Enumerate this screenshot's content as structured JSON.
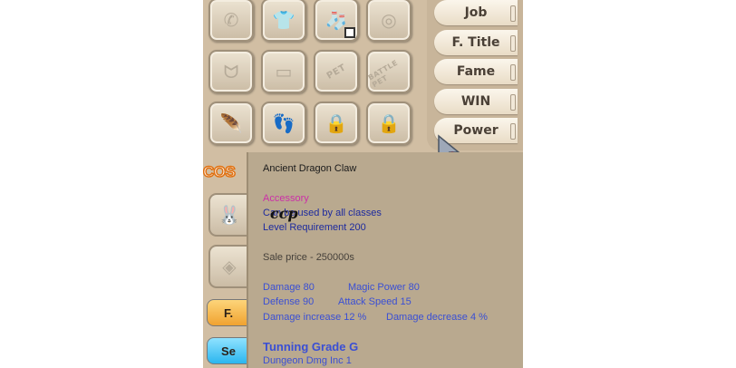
{
  "grid": {
    "slots": [
      {
        "name": "phone-icon",
        "glyph": "✆"
      },
      {
        "name": "shirt-icon",
        "glyph": "👕"
      },
      {
        "name": "sock-icon",
        "glyph": "🧦"
      },
      {
        "name": "ring-icon",
        "glyph": "◎"
      },
      {
        "name": "necklace-icon",
        "glyph": "ᗢ"
      },
      {
        "name": "shorts-icon",
        "glyph": "▭"
      },
      {
        "name": "pet-icon",
        "text": "PET"
      },
      {
        "name": "battle-pet-icon",
        "text": "BATTLE PET"
      },
      {
        "name": "dragon-claw-icon",
        "glyph": "🪶"
      },
      {
        "name": "footprint-icon",
        "glyph": "👣"
      },
      {
        "name": "lock-icon",
        "glyph": "🔒"
      },
      {
        "name": "lock-icon",
        "glyph": "🔒"
      }
    ]
  },
  "right_panel": {
    "buttons": [
      "Job",
      "F. Title",
      "Fame",
      "WIN",
      "Power"
    ]
  },
  "sidebar": {
    "costume_label": "COS",
    "btn1_label": "F.",
    "btn2_label": "Se"
  },
  "tooltip": {
    "item_name": "Ancient Dragon Claw",
    "category": "Accessory",
    "usable_by": "Can be used by all classes",
    "level_req": "Level Requirement 200",
    "sale_price": "Sale price - 250000s",
    "damage": "Damage 80",
    "magic_power": "Magic Power 80",
    "defense": "Defense 90",
    "attack_speed": "Attack Speed 15",
    "damage_increase": "Damage increase 12 %",
    "damage_decrease": "Damage decrease 4 %",
    "tuning_grade": "Tunning Grade G",
    "dungeon_dmg": "Dungeon Dmg Inc 1",
    "signature": "ccp"
  },
  "colors": {
    "accessory": "#cc2fa8",
    "requirement": "#1d2a9e",
    "stats": "#3a4fd4"
  }
}
